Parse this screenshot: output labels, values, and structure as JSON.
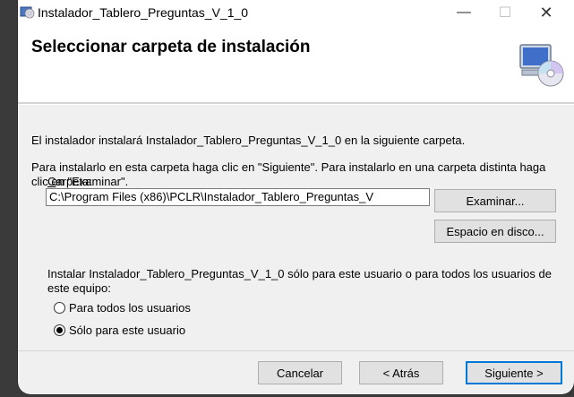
{
  "window": {
    "title": "Instalador_Tablero_Preguntas_V_1_0",
    "minimize_glyph": "—",
    "maximize_glyph": "☐",
    "close_glyph": "✕"
  },
  "header": {
    "title": "Seleccionar carpeta de instalación",
    "icon": "computer-cd-icon"
  },
  "body": {
    "intro": "El instalador instalará Instalador_Tablero_Preguntas_V_1_0 en la siguiente carpeta.",
    "instructions": "Para instalarlo en esta carpeta haga clic en \"Siguiente\". Para instalarlo en una carpeta distinta haga clic en \"Examinar\".",
    "folder_label_accel": "C",
    "folder_label_rest": "arpeta:",
    "folder_path": "C:\\Program Files (x86)\\PCLR\\Instalador_Tablero_Preguntas_V",
    "browse_label": "Examinar...",
    "disk_space_label": "Espacio en disco...",
    "scope_question": "Instalar Instalador_Tablero_Preguntas_V_1_0 sólo para este usuario o para todos los usuarios de este equipo:",
    "options": [
      {
        "label": "Para todos los usuarios",
        "selected": false
      },
      {
        "label": "Sólo para este usuario",
        "selected": true
      }
    ]
  },
  "footer": {
    "cancel_label": "Cancelar",
    "back_label": "< Atrás",
    "next_label": "Siguiente >"
  }
}
